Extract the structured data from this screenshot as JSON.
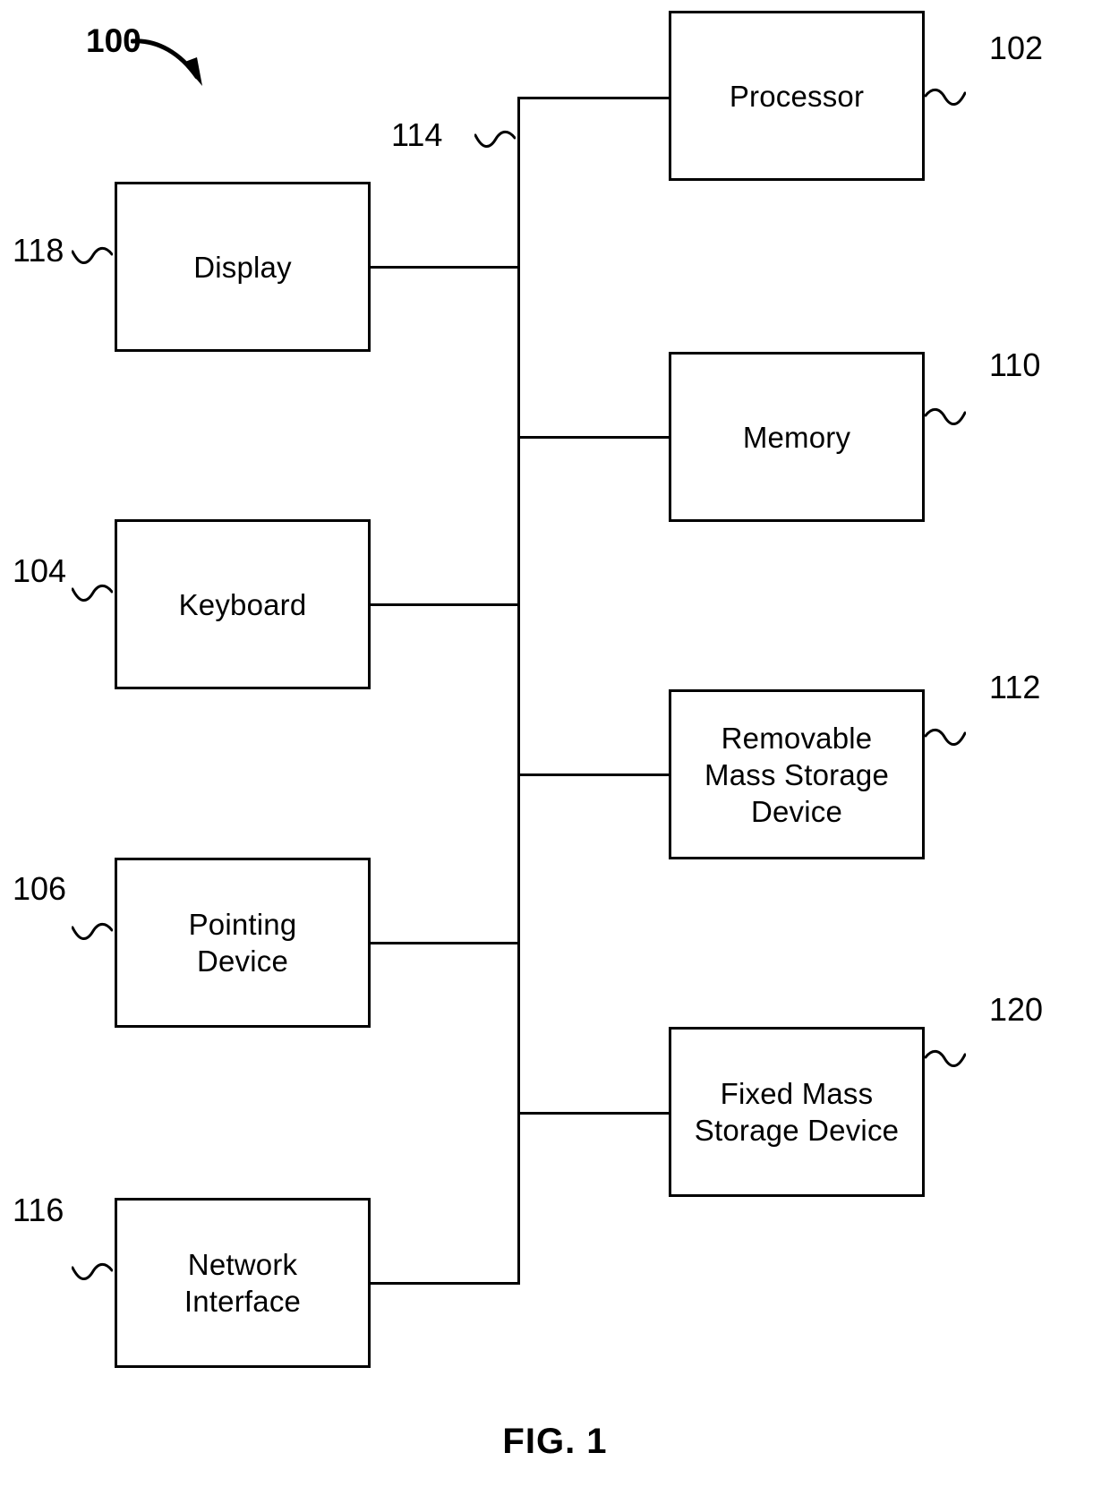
{
  "figure": {
    "caption": "FIG. 1",
    "system_numeral": "100",
    "line_color": "#000000",
    "background_color": "#ffffff"
  },
  "blocks": [
    {
      "id": "display",
      "label": "Display",
      "numeral": "118",
      "column": "left"
    },
    {
      "id": "keyboard",
      "label": "Keyboard",
      "numeral": "104",
      "column": "left"
    },
    {
      "id": "pointing",
      "label": "Pointing\nDevice",
      "numeral": "106",
      "column": "left"
    },
    {
      "id": "network",
      "label": "Network\nInterface",
      "numeral": "116",
      "column": "left"
    },
    {
      "id": "processor",
      "label": "Processor",
      "numeral": "102",
      "column": "right"
    },
    {
      "id": "memory",
      "label": "Memory",
      "numeral": "110",
      "column": "right"
    },
    {
      "id": "removable",
      "label": "Removable\nMass Storage\nDevice",
      "numeral": "112",
      "column": "right"
    },
    {
      "id": "fixed",
      "label": "Fixed Mass\nStorage Device",
      "numeral": "120",
      "column": "right"
    }
  ],
  "bus": {
    "numeral": "114",
    "name": "system bus"
  }
}
